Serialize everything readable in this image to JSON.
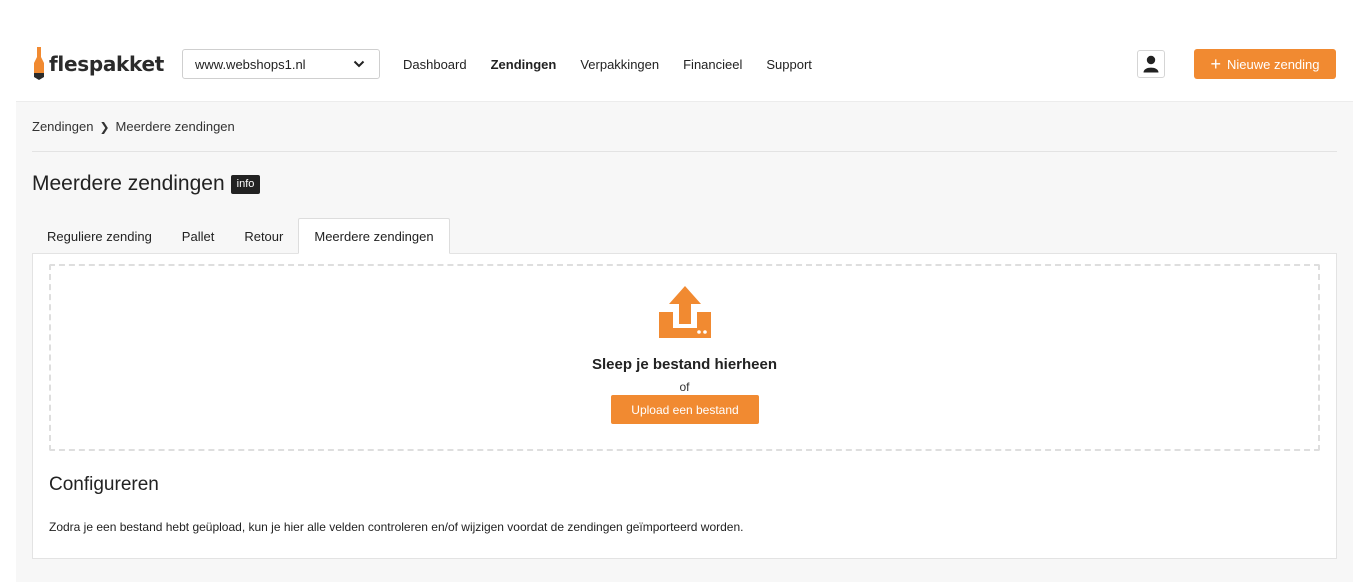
{
  "brand": {
    "name": "flespakket",
    "accent": "#f18a31"
  },
  "header": {
    "shop_select": {
      "value": "www.webshops1.nl"
    },
    "nav": [
      {
        "label": "Dashboard",
        "active": false
      },
      {
        "label": "Zendingen",
        "active": true
      },
      {
        "label": "Verpakkingen",
        "active": false
      },
      {
        "label": "Financieel",
        "active": false
      },
      {
        "label": "Support",
        "active": false
      }
    ],
    "user_icon": "user-icon",
    "new_shipment_label": "Nieuwe zending"
  },
  "breadcrumb": [
    "Zendingen",
    "Meerdere zendingen"
  ],
  "page": {
    "title": "Meerdere zendingen",
    "info_badge": "info"
  },
  "tabs": [
    {
      "label": "Reguliere zending",
      "active": false
    },
    {
      "label": "Pallet",
      "active": false
    },
    {
      "label": "Retour",
      "active": false
    },
    {
      "label": "Meerdere zendingen",
      "active": true
    }
  ],
  "dropzone": {
    "icon": "upload-icon",
    "title": "Sleep je bestand hierheen",
    "or": "of",
    "button": "Upload een bestand"
  },
  "configure": {
    "title": "Configureren",
    "text": "Zodra je een bestand hebt geüpload, kun je hier alle velden controleren en/of wijzigen voordat de zendingen geïmporteerd worden."
  }
}
